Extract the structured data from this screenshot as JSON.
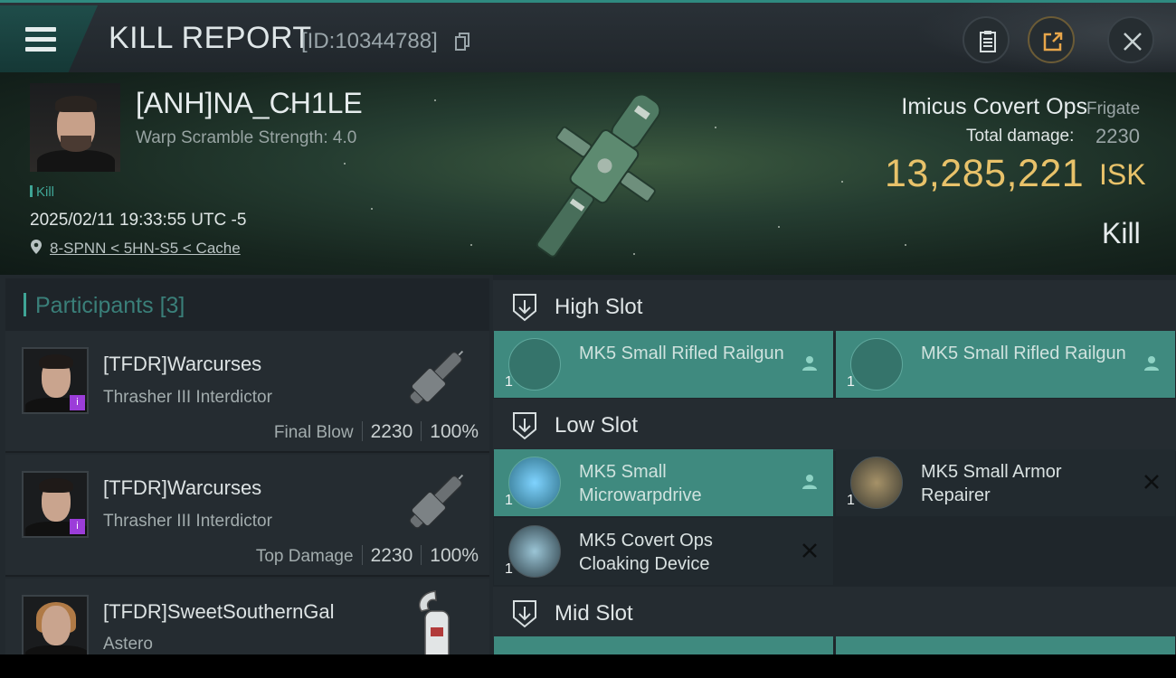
{
  "header": {
    "title": "KILL REPORT",
    "report_id": "[ID:10344788]"
  },
  "victim": {
    "name": "[ANH]NA_CH1LE",
    "warp_scramble": "Warp Scramble Strength: 4.0",
    "tag": "Kill",
    "datetime": "2025/02/11 19:33:55 UTC -5",
    "location": "8-SPNN < 5HN-S5 < Cache",
    "ship_name": "Imicus Covert Ops",
    "ship_class": "Frigate",
    "total_damage_label": "Total damage:",
    "total_damage": "2230",
    "isk_value": "13,285,221",
    "isk_unit": "ISK",
    "result": "Kill"
  },
  "participants": {
    "title": "Participants",
    "count": "[3]",
    "rows": [
      {
        "name": "[TFDR]Warcurses",
        "ship": "Thrasher III Interdictor",
        "label": "Final Blow",
        "damage": "2230",
        "percent": "100%"
      },
      {
        "name": "[TFDR]Warcurses",
        "ship": "Thrasher III Interdictor",
        "label": "Top Damage",
        "damage": "2230",
        "percent": "100%"
      },
      {
        "name": "[TFDR]SweetSouthernGal",
        "ship": "Astero"
      }
    ]
  },
  "fitting": {
    "high_slot": {
      "title": "High Slot",
      "modules": [
        {
          "qty": "1",
          "name": "MK5 Small Rifled Railgun",
          "status": "dropped"
        },
        {
          "qty": "1",
          "name": "MK5 Small Rifled Railgun",
          "status": "dropped"
        }
      ]
    },
    "low_slot": {
      "title": "Low Slot",
      "modules": [
        {
          "qty": "1",
          "name": "MK5 Small Microwarpdrive",
          "status": "dropped"
        },
        {
          "qty": "1",
          "name": "MK5 Small Armor Repairer",
          "status": "destroyed"
        },
        {
          "qty": "1",
          "name": "MK5 Covert Ops Cloaking Device",
          "status": "destroyed"
        }
      ]
    },
    "mid_slot": {
      "title": "Mid Slot"
    }
  },
  "colors": {
    "accent": "#3fa596",
    "isk": "#e8c26a",
    "dropped_module": "#3f8a7f",
    "purple_badge": "#9b3dd9"
  },
  "icons": [
    "menu-icon",
    "copy-icon",
    "clipboard-icon",
    "share-icon",
    "close-icon",
    "location-pin-icon",
    "slot-icon",
    "pilot-icon",
    "destroyed-x-icon"
  ]
}
